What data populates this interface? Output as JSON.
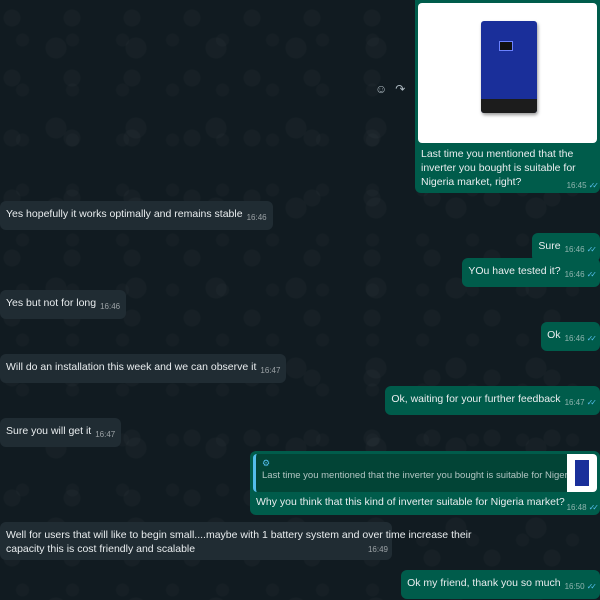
{
  "hover_actions": {
    "emoji_icon": "☺",
    "forward_icon": "↷"
  },
  "image_message": {
    "caption": "Last time you mentioned that the inverter you bought is suitable for Nigeria market, right?",
    "time": "16:45",
    "ticks": "✓✓"
  },
  "messages": [
    {
      "text": "Yes hopefully  it works optimally  and remains stable",
      "time": "16:46"
    },
    {
      "text": "Sure",
      "time": "16:46",
      "ticks": "✓✓"
    },
    {
      "text": "YOu have tested it?",
      "time": "16:46",
      "ticks": "✓✓"
    },
    {
      "text": "Yes but not for long",
      "time": "16:46"
    },
    {
      "text": "Ok",
      "time": "16:46",
      "ticks": "✓✓"
    },
    {
      "text": "Will do an installation this week and we can observe it",
      "time": "16:47"
    },
    {
      "text": "Ok, waiting for your further feedback",
      "time": "16:47",
      "ticks": "✓✓"
    },
    {
      "text": "Sure you will get it",
      "time": "16:47"
    }
  ],
  "reply_message": {
    "quote_icon": "⚙",
    "quoted_text": "Last time you mentioned that the inverter you bought is suitable for Nigeria market, right?",
    "text": "Why you think that this kind of inverter suitable for Nigeria market?",
    "time": "16:48",
    "ticks": "✓✓"
  },
  "long_message": {
    "line1": "Well for users that will like to begin small....maybe with 1 battery  system and over  time increase their",
    "line2": "capacity  this is cost friendly and scalable",
    "time": "16:49"
  },
  "last_message": {
    "text": "Ok my friend, thank you so much",
    "time": "16:50",
    "ticks": "✓✓"
  }
}
